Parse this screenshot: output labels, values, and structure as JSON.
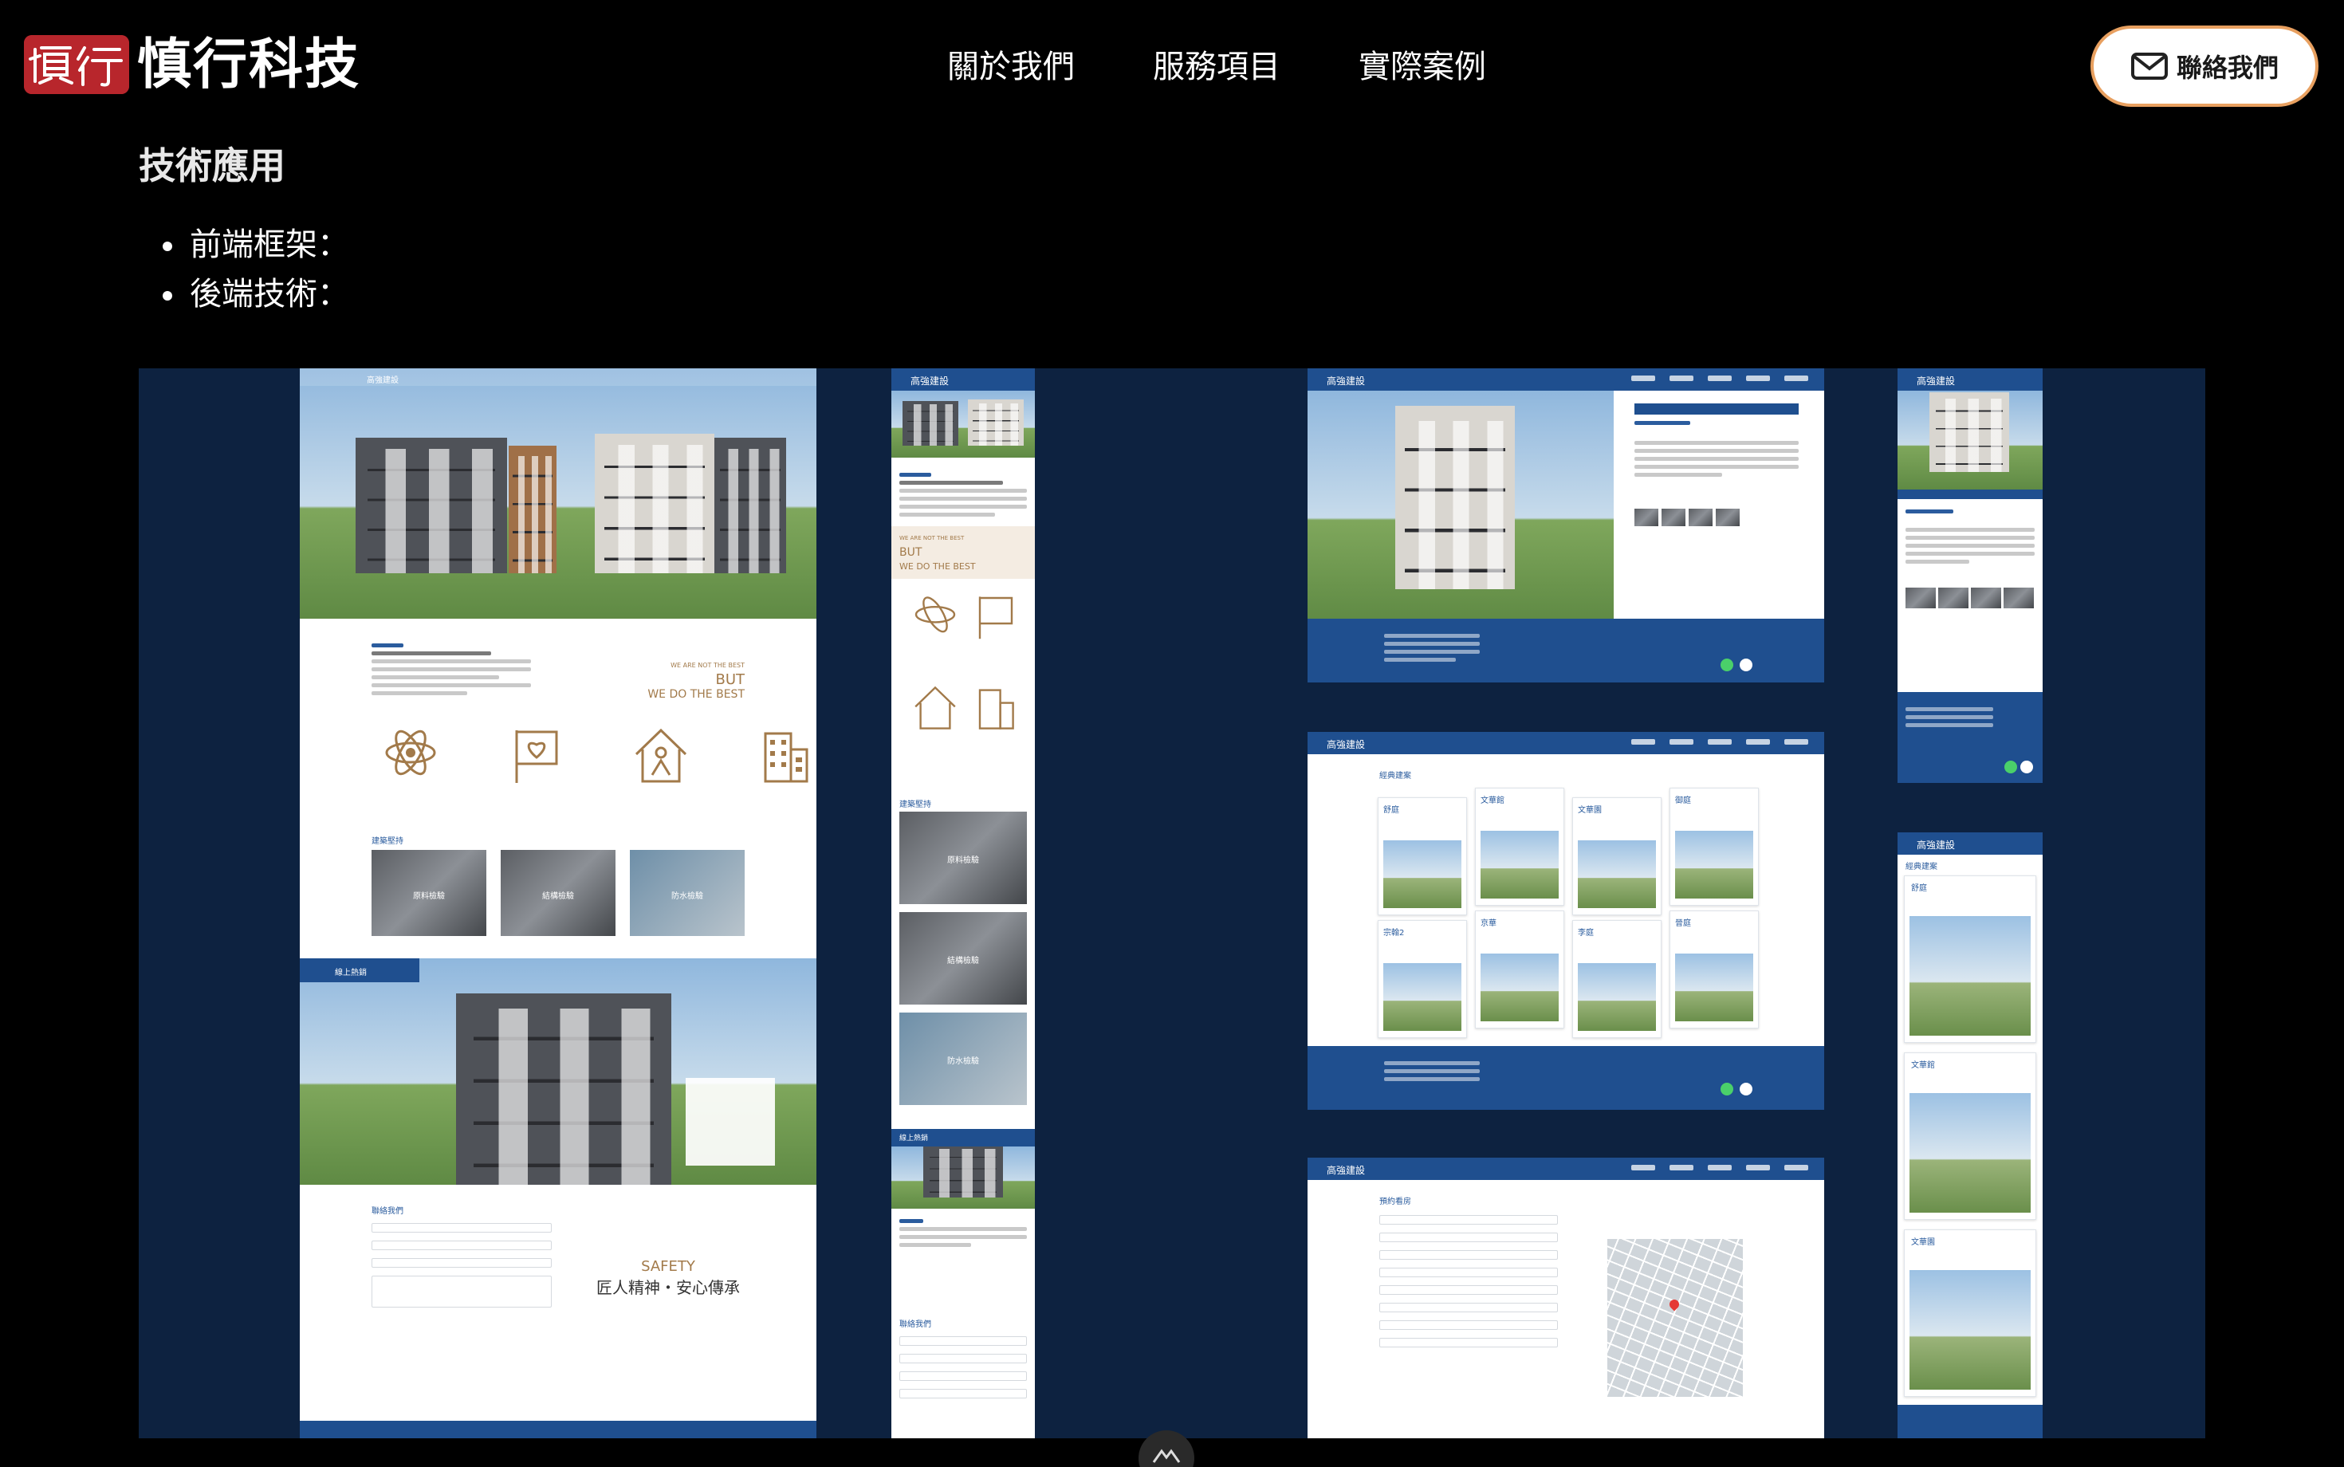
{
  "brand": {
    "name": "慎行科技",
    "logo_glyphs": "慎行",
    "logo_color": "#b8262c"
  },
  "nav": {
    "items": [
      {
        "label": "關於我們"
      },
      {
        "label": "服務項目"
      },
      {
        "label": "實際案例"
      }
    ],
    "contact_label": "聯絡我們",
    "contact_icon": "mail-icon",
    "accent_color": "#e8a060"
  },
  "section": {
    "title": "技術應用",
    "bullets": [
      {
        "label": "前端框架："
      },
      {
        "label": "後端技術："
      }
    ]
  },
  "gallery": {
    "background": "#0d2240",
    "site_brand": "高強建設",
    "hero_text": {
      "line1": "WE ARE NOT THE BEST",
      "line2": "BUT",
      "line3": "WE DO THE BEST"
    },
    "features_title": "建築堅持",
    "features": [
      {
        "label": "原料檢驗"
      },
      {
        "label": "結構檢驗"
      },
      {
        "label": "防水檢驗"
      }
    ],
    "online_hot": "線上熱銷",
    "contact_title": "聯絡我們",
    "safety": {
      "en": "SAFETY",
      "zh": "匠人精神・安心傳承"
    },
    "cases_title": "經典建案",
    "booking_title": "預約看房",
    "cases": [
      {
        "name": "舒庭"
      },
      {
        "name": "文華館"
      },
      {
        "name": "文華園"
      },
      {
        "name": "御庭"
      },
      {
        "name": "宗翰2"
      },
      {
        "name": "京華"
      },
      {
        "name": "李庭"
      },
      {
        "name": "晉庭"
      }
    ],
    "scroll_icon": "chevron-up-icon"
  }
}
